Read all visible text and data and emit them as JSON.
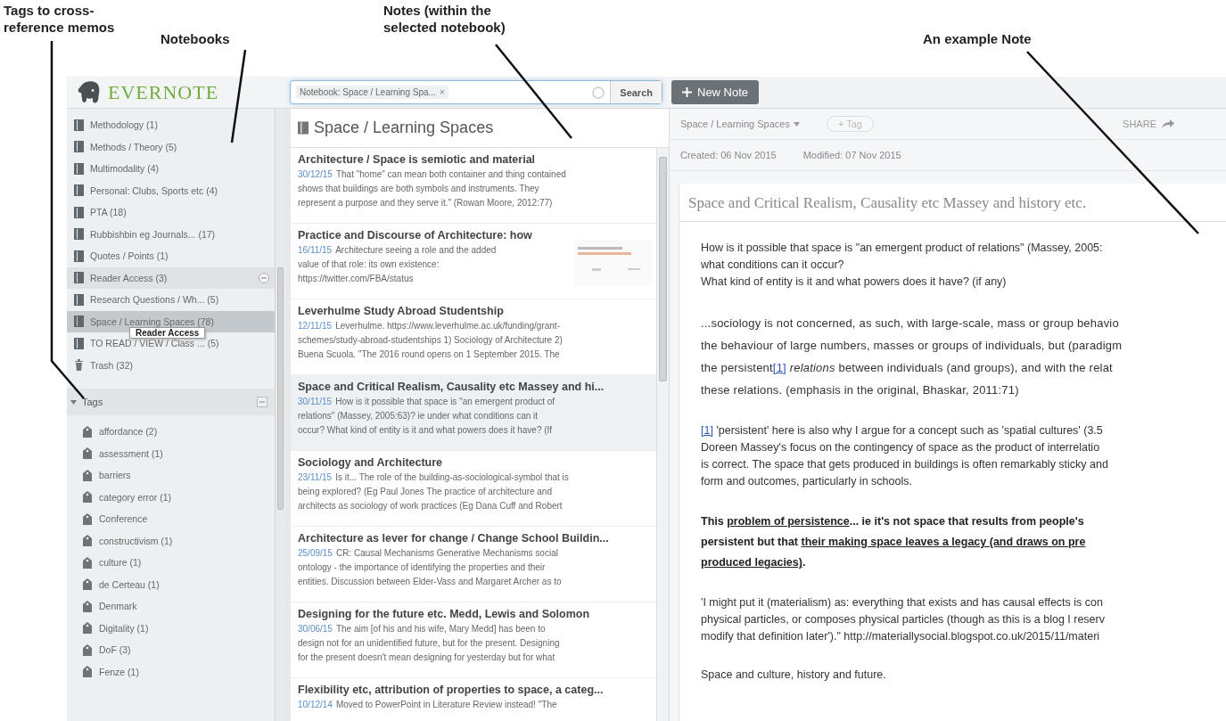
{
  "annotations": [
    {
      "lines": [
        "Tags to cross-",
        "reference memos"
      ]
    },
    {
      "lines": [
        "Notebooks"
      ]
    },
    {
      "lines": [
        "Notes (within the",
        "selected notebook)"
      ]
    },
    {
      "lines": [
        "An example Note"
      ]
    }
  ],
  "logo": {
    "text": "EVERNOTE"
  },
  "search": {
    "token": "Notebook: Space / Learning Spa...",
    "token_close": "×",
    "button": "Search"
  },
  "new_note": {
    "label": "New Note"
  },
  "notebooks": [
    {
      "name": "Methodology (1)",
      "selected": false,
      "hovered": false,
      "kind": "notebook"
    },
    {
      "name": "Methods / Theory (5)",
      "selected": false,
      "hovered": false,
      "kind": "notebook"
    },
    {
      "name": "Multimodality (4)",
      "selected": false,
      "hovered": false,
      "kind": "notebook"
    },
    {
      "name": "Personal: Clubs, Sports etc (4)",
      "selected": false,
      "hovered": false,
      "kind": "notebook"
    },
    {
      "name": "PTA (18)",
      "selected": false,
      "hovered": false,
      "kind": "notebook"
    },
    {
      "name": "Rubbishbin eg Journals...   (17)",
      "selected": false,
      "hovered": false,
      "kind": "notebook"
    },
    {
      "name": "Quotes / Points (1)",
      "selected": false,
      "hovered": false,
      "kind": "notebook"
    },
    {
      "name": "Reader Access (3)",
      "selected": false,
      "hovered": true,
      "kind": "notebook"
    },
    {
      "name": "Research Questions / Wh...   (5)",
      "selected": false,
      "hovered": false,
      "kind": "notebook"
    },
    {
      "name": "Space / Learning Spaces (78)",
      "selected": true,
      "hovered": false,
      "kind": "notebook"
    },
    {
      "name": "TO READ / VIEW / Class ...   (5)",
      "selected": false,
      "hovered": false,
      "kind": "notebook"
    },
    {
      "name": "Trash (32)",
      "selected": false,
      "hovered": false,
      "kind": "trash"
    }
  ],
  "tooltip": "Reader Access",
  "tags_header": {
    "label": "Tags",
    "expanded": true
  },
  "tags": [
    "affordance (2)",
    "assessment (1)",
    "barriers",
    "category error (1)",
    "Conference",
    "constructivism (1)",
    "culture (1)",
    "de Certeau (1)",
    "Denmark",
    "Digitality (1)",
    "DoF (3)",
    "Fenze (1)"
  ],
  "notes_header": "Space / Learning Spaces",
  "notes": [
    {
      "title": "Architecture / Space is semiotic and material",
      "date": "30/12/15",
      "selected": false,
      "lines": [
        "That \"home\" can mean both container and thing contained",
        "shows that buildings are both symbols and instruments. They",
        "represent a purpose and they serve it.\" (Rowan Moore, 2012:77)"
      ]
    },
    {
      "title": "Practice and Discourse of Architecture: how",
      "date": "16/11/15",
      "selected": false,
      "kind": "thumbnail",
      "lines": [
        "Architecture seeing a role and the added",
        "value of that role: its own existence:",
        "https://twitter.com/FBA/status"
      ]
    },
    {
      "title": "Leverhulme Study Abroad Studentship",
      "date": "12/11/15",
      "selected": false,
      "lines": [
        "Leverhulme. https://www.leverhulme.ac.uk/funding/grant-",
        "schemes/study-abroad-studentships 1) Sociology of Architecture 2)",
        "Buena Scuola. \"The 2016 round opens on 1 September 2015. The"
      ]
    },
    {
      "title": "Space and Critical Realism, Causality etc Massey and hi...",
      "date": "30/11/15",
      "selected": true,
      "lines": [
        "How is it possible that space is \"an emergent product of",
        "relations\" (Massey, 2005:63)? ie under what conditions can it",
        "occur? What kind of entity is it and what powers does it have? (If"
      ]
    },
    {
      "title": "Sociology and Architecture",
      "date": "23/11/15",
      "selected": false,
      "lines": [
        "Is it... The role of the building-as-sociological-symbol that is",
        "being explored? (Eg Paul Jones The practice of architecture and",
        "architects as sociology of work practices (Eg Dana Cuff and Robert"
      ]
    },
    {
      "title": "Architecture as lever for change / Change School Buildin...",
      "date": "25/09/15",
      "selected": false,
      "lines": [
        "CR: Causal Mechanisms Generative Mechanisms social",
        "ontology - the importance of identifying the properties and their",
        "entities. Discussion between Elder-Vass and Margaret Archer as to"
      ]
    },
    {
      "title": "Designing for the future etc. Medd, Lewis and Solomon",
      "date": "30/06/15",
      "selected": false,
      "lines": [
        "The aim [of his and his wife, Mary Medd] has been to",
        "design not for an unidentified future, but for the present. Designing",
        "for the present doesn't mean designing for yesterday but for what"
      ]
    },
    {
      "title": "Flexibility etc, attribution of properties to space, a categ...",
      "date": "10/12/14",
      "selected": false,
      "lines": [
        "Moved to PowerPoint in Literature Review instead! \"The"
      ]
    }
  ],
  "note": {
    "notebook": "Space / Learning Spaces",
    "tag_button": "+ Tag",
    "share": "SHARE",
    "created": "Created: 06 Nov 2015",
    "modified": "Modified: 07 Nov 2015",
    "title": "Space and Critical Realism, Causality etc Massey and history etc.",
    "paragraphs": [
      {
        "kind": "plain",
        "lines": [
          "How is it possible that space is \"an emergent product of relations\" (Massey, 2005:",
          "what conditions can it occur?",
          "What kind of entity is it and what powers does it have? (if any)"
        ]
      },
      {
        "kind": "quote",
        "lines": [
          "...sociology is not concerned, as such, with large-scale, mass or group behavio",
          "the behaviour of large numbers, masses or groups of individuals, but (paradigm",
          [
            {
              "text": "the persistent",
              "kind": "plain"
            },
            {
              "text": "[1]",
              "kind": "link"
            },
            {
              "text": " relations",
              "kind": "italic"
            },
            {
              "text": " between individuals (and groups), and with the relat",
              "kind": "plain"
            }
          ],
          "these relations. (emphasis in the original, Bhaskar, 2011:71)"
        ]
      },
      {
        "kind": "plain",
        "lines": [
          [
            {
              "text": "[1]",
              "kind": "link"
            },
            {
              "text": " 'persistent' here is also why I argue for a concept such as 'spatial cultures' (3.5",
              "kind": "plain"
            }
          ],
          "Doreen Massey's focus on the contingency of space as the product of interrelatio",
          "is correct. The space that gets produced in buildings is often remarkably sticky and",
          "form and outcomes, particularly in schools."
        ]
      },
      {
        "kind": "bold",
        "lines": [
          [
            {
              "text": "This ",
              "kind": "plain"
            },
            {
              "text": "problem of persistence",
              "kind": "underline"
            },
            {
              "text": "... ie it's not space that results from people's",
              "kind": "plain"
            }
          ],
          [
            {
              "text": "persistent but that ",
              "kind": "plain"
            },
            {
              "text": "their making space leaves a legacy (and draws on pre",
              "kind": "underline"
            }
          ],
          [
            {
              "text": "produced legacies)",
              "kind": "underline"
            },
            {
              "text": ".",
              "kind": "plain"
            }
          ]
        ]
      },
      {
        "kind": "plain",
        "lines": [
          "'I might put it (materialism) as: everything that exists and has causal effects is con",
          "physical particles, or composes physical particles (though as this is a blog I reserv",
          "modify that definition later').\" http://materiallysocial.blogspot.co.uk/2015/11/materi"
        ]
      },
      {
        "kind": "plain",
        "lines": [
          "Space and culture, history and future."
        ]
      }
    ]
  }
}
